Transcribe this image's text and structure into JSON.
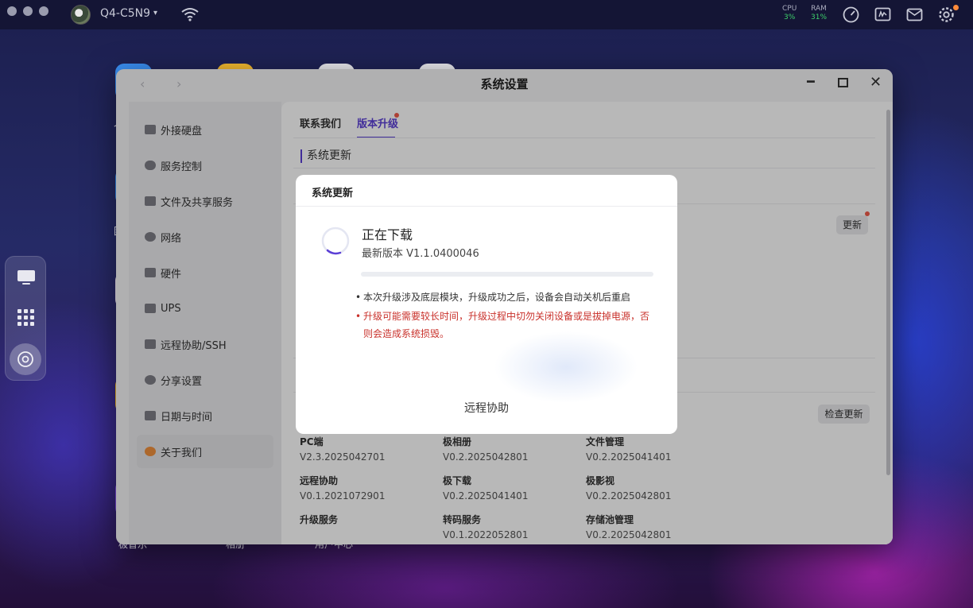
{
  "topbar": {
    "device_name": "Q4-C5N9",
    "cpu_label": "CPU",
    "cpu_value": "3%",
    "ram_label": "RAM",
    "ram_value": "31%",
    "status_color": "#3dd06a"
  },
  "desktop": {
    "labels": [
      "个人",
      "团队",
      "极",
      "极",
      "极音乐",
      "相册",
      "用户中心"
    ]
  },
  "window": {
    "title": "系统设置",
    "sidebar": {
      "items": [
        {
          "label": "外接硬盘",
          "icon": "drive-icon"
        },
        {
          "label": "服务控制",
          "icon": "toggle-icon"
        },
        {
          "label": "文件及共享服务",
          "icon": "file-share-icon"
        },
        {
          "label": "网络",
          "icon": "globe-icon"
        },
        {
          "label": "硬件",
          "icon": "grid-icon"
        },
        {
          "label": "UPS",
          "icon": "ups-icon"
        },
        {
          "label": "远程协助/SSH",
          "icon": "monitor-icon"
        },
        {
          "label": "分享设置",
          "icon": "share-icon"
        },
        {
          "label": "日期与时间",
          "icon": "calendar-icon"
        },
        {
          "label": "关于我们",
          "icon": "people-icon"
        }
      ],
      "active": "关于我们"
    },
    "tabs": [
      {
        "label": "联系我们"
      },
      {
        "label": "版本升级"
      }
    ],
    "active_tab": "版本升级",
    "section_title": "系统更新",
    "update_button": "更新",
    "check_update_button": "检查更新",
    "apps": [
      {
        "name": "PC端",
        "version": "V2.3.2025042701"
      },
      {
        "name": "极相册",
        "version": "V0.2.2025042801"
      },
      {
        "name": "文件管理",
        "version": "V0.2.2025041401"
      },
      {
        "name": "远程协助",
        "version": "V0.1.2021072901"
      },
      {
        "name": "极下载",
        "version": "V0.2.2025041401"
      },
      {
        "name": "极影视",
        "version": "V0.2.2025042801"
      },
      {
        "name": "升级服务",
        "version": ""
      },
      {
        "name": "转码服务",
        "version": "V0.1.2022052801"
      },
      {
        "name": "存储池管理",
        "version": "V0.2.2025042801"
      }
    ]
  },
  "dialog": {
    "title": "系统更新",
    "status": "正在下载",
    "version_line": "最新版本 V1.1.0400046",
    "progress": 0.0,
    "note_1": "本次升级涉及底层模块，升级成功之后，设备会自动关机后重启",
    "note_2": "升级可能需要较长时间，升级过程中切勿关闭设备或是拔掉电源，否则会造成系统损毁。",
    "remote_assist": "远程协助",
    "accent_color": "#5b3fd6",
    "warning_color": "#c9312b"
  }
}
